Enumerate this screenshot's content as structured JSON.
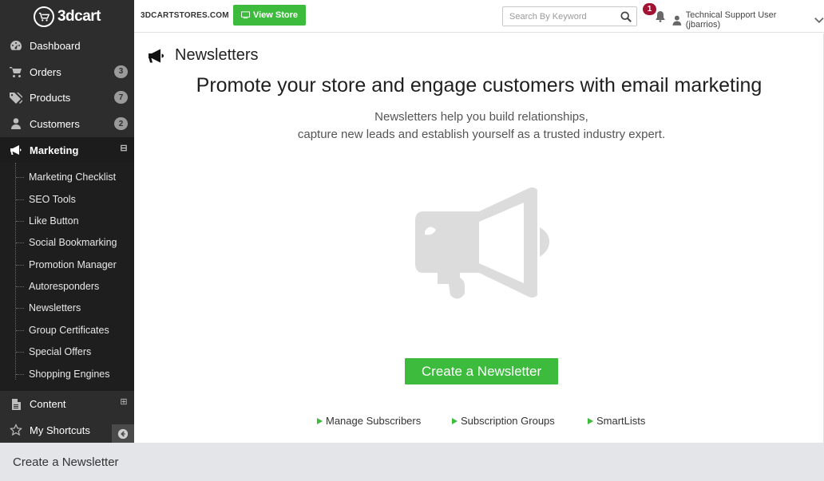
{
  "brand": {
    "logo_text": "3dcart"
  },
  "sidebar": {
    "items": [
      {
        "label": "Dashboard",
        "icon": "dashboard-icon"
      },
      {
        "label": "Orders",
        "icon": "cart-icon",
        "badge": "3"
      },
      {
        "label": "Products",
        "icon": "tags-icon",
        "badge": "7"
      },
      {
        "label": "Customers",
        "icon": "user-icon",
        "badge": "2"
      },
      {
        "label": "Marketing",
        "icon": "bullhorn-icon",
        "toggle": "⊟"
      }
    ],
    "marketing_submenu": [
      "Marketing Checklist",
      "SEO Tools",
      "Like Button",
      "Social Bookmarking",
      "Promotion Manager",
      "Autoresponders",
      "Newsletters",
      "Group Certificates",
      "Special Offers",
      "Shopping Engines"
    ],
    "bottom_items": [
      {
        "label": "Content",
        "icon": "document-icon",
        "toggle": "⊞"
      },
      {
        "label": "My Shortcuts",
        "icon": "star-icon"
      }
    ]
  },
  "header": {
    "store_name": "3DCARTSTORES.COM",
    "view_store_label": "View Store",
    "search_placeholder": "Search By Keyword",
    "notification_count": "1",
    "user_label": "Technical Support User (jbarrios)"
  },
  "main": {
    "page_title": "Newsletters",
    "headline": "Promote your store and engage customers with email marketing",
    "subline_1": "Newsletters help you build relationships,",
    "subline_2": "capture new leads and establish yourself as a trusted industry expert.",
    "create_button": "Create a Newsletter",
    "links": [
      "Manage Subscribers",
      "Subscription Groups",
      "SmartLists"
    ]
  },
  "footer": {
    "caption": "Create a Newsletter"
  },
  "colors": {
    "sidebar_bg": "#2d2d2d",
    "accent_green": "#3dbb3d",
    "notification_red": "#a11233",
    "illustration_gray": "#dcdcdc"
  }
}
